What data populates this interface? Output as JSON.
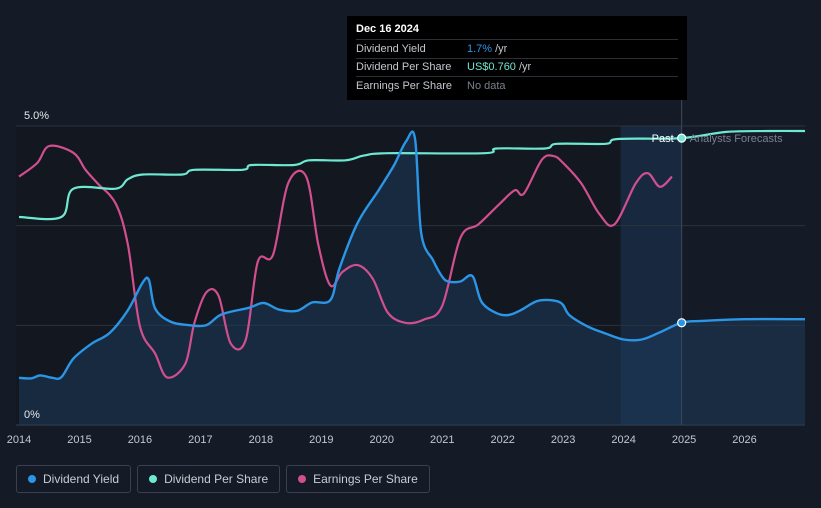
{
  "tooltip": {
    "date": "Dec 16 2024",
    "rows": [
      {
        "label": "Dividend Yield",
        "value": "1.7%",
        "unit": "/yr",
        "color": "#2b95e6"
      },
      {
        "label": "Dividend Per Share",
        "value": "US$0.760",
        "unit": "/yr",
        "color": "#6fe8d2"
      },
      {
        "label": "Earnings Per Share",
        "value": "No data",
        "unit": "",
        "color": "#7a808b"
      }
    ]
  },
  "legend": [
    {
      "label": "Dividend Yield",
      "color": "#2b95e6"
    },
    {
      "label": "Dividend Per Share",
      "color": "#6fe8d2"
    },
    {
      "label": "Earnings Per Share",
      "color": "#d14f8f"
    }
  ],
  "regions": {
    "past_label": "Past",
    "forecast_label": "Analysts Forecasts"
  },
  "chart_data": {
    "type": "line",
    "title": "",
    "xlabel": "",
    "ylabel": "",
    "x_ticks": [
      "2014",
      "2015",
      "2016",
      "2017",
      "2018",
      "2019",
      "2020",
      "2021",
      "2022",
      "2023",
      "2024",
      "2025",
      "2026"
    ],
    "xlim": [
      2013.95,
      2027.0
    ],
    "y_ticks": [
      "0%",
      "5.0%"
    ],
    "ylim": [
      0,
      5.0
    ],
    "grid": true,
    "legend_position": "bottom-left",
    "highlight_date": 2024.96,
    "series": [
      {
        "name": "Dividend Yield",
        "color": "#2b95e6",
        "unit": "%",
        "points": [
          [
            2014.0,
            0.79
          ],
          [
            2014.2,
            0.78
          ],
          [
            2014.35,
            0.83
          ],
          [
            2014.55,
            0.79
          ],
          [
            2014.7,
            0.8
          ],
          [
            2014.9,
            1.11
          ],
          [
            2015.2,
            1.36
          ],
          [
            2015.5,
            1.54
          ],
          [
            2015.8,
            1.92
          ],
          [
            2016.05,
            2.39
          ],
          [
            2016.15,
            2.42
          ],
          [
            2016.25,
            1.95
          ],
          [
            2016.5,
            1.73
          ],
          [
            2016.8,
            1.67
          ],
          [
            2017.1,
            1.67
          ],
          [
            2017.35,
            1.85
          ],
          [
            2017.8,
            1.96
          ],
          [
            2018.05,
            2.04
          ],
          [
            2018.3,
            1.93
          ],
          [
            2018.6,
            1.91
          ],
          [
            2018.85,
            2.05
          ],
          [
            2019.15,
            2.09
          ],
          [
            2019.3,
            2.62
          ],
          [
            2019.6,
            3.38
          ],
          [
            2019.95,
            3.93
          ],
          [
            2020.2,
            4.34
          ],
          [
            2020.4,
            4.74
          ],
          [
            2020.55,
            4.79
          ],
          [
            2020.65,
            3.22
          ],
          [
            2020.85,
            2.75
          ],
          [
            2021.0,
            2.48
          ],
          [
            2021.1,
            2.4
          ],
          [
            2021.3,
            2.4
          ],
          [
            2021.5,
            2.49
          ],
          [
            2021.65,
            2.06
          ],
          [
            2021.9,
            1.87
          ],
          [
            2022.1,
            1.84
          ],
          [
            2022.3,
            1.92
          ],
          [
            2022.6,
            2.08
          ],
          [
            2022.95,
            2.05
          ],
          [
            2023.1,
            1.84
          ],
          [
            2023.4,
            1.65
          ],
          [
            2023.7,
            1.53
          ],
          [
            2024.0,
            1.43
          ],
          [
            2024.3,
            1.43
          ],
          [
            2024.6,
            1.55
          ],
          [
            2024.96,
            1.71
          ],
          [
            2025.3,
            1.74
          ],
          [
            2026.0,
            1.77
          ],
          [
            2027.0,
            1.77
          ]
        ]
      },
      {
        "name": "Dividend Per Share",
        "color": "#6fe8d2",
        "unit": "US$",
        "points": [
          [
            2014.0,
            0.44
          ],
          [
            2014.7,
            0.44
          ],
          [
            2014.9,
            0.5
          ],
          [
            2015.6,
            0.5
          ],
          [
            2015.8,
            0.52
          ],
          [
            2016.05,
            0.53
          ],
          [
            2016.7,
            0.53
          ],
          [
            2016.9,
            0.54
          ],
          [
            2017.7,
            0.54
          ],
          [
            2017.85,
            0.55
          ],
          [
            2018.55,
            0.55
          ],
          [
            2018.8,
            0.56
          ],
          [
            2019.4,
            0.56
          ],
          [
            2019.7,
            0.57
          ],
          [
            2020.1,
            0.575
          ],
          [
            2021.7,
            0.575
          ],
          [
            2021.9,
            0.585
          ],
          [
            2022.7,
            0.585
          ],
          [
            2022.9,
            0.595
          ],
          [
            2023.7,
            0.595
          ],
          [
            2023.9,
            0.605
          ],
          [
            2024.96,
            0.607
          ],
          [
            2025.7,
            0.62
          ],
          [
            2026.4,
            0.622
          ],
          [
            2027.0,
            0.622
          ]
        ]
      },
      {
        "name": "Earnings Per Share",
        "color": "#d14f8f",
        "unit": "US$",
        "points": [
          [
            2014.0,
            0.73
          ],
          [
            2014.3,
            0.77
          ],
          [
            2014.5,
            0.82
          ],
          [
            2014.9,
            0.8
          ],
          [
            2015.1,
            0.75
          ],
          [
            2015.3,
            0.71
          ],
          [
            2015.6,
            0.65
          ],
          [
            2015.8,
            0.53
          ],
          [
            2016.0,
            0.29
          ],
          [
            2016.25,
            0.21
          ],
          [
            2016.45,
            0.14
          ],
          [
            2016.75,
            0.18
          ],
          [
            2016.9,
            0.3
          ],
          [
            2017.1,
            0.39
          ],
          [
            2017.3,
            0.38
          ],
          [
            2017.5,
            0.24
          ],
          [
            2017.75,
            0.25
          ],
          [
            2017.95,
            0.48
          ],
          [
            2018.2,
            0.5
          ],
          [
            2018.45,
            0.71
          ],
          [
            2018.75,
            0.73
          ],
          [
            2018.95,
            0.53
          ],
          [
            2019.15,
            0.41
          ],
          [
            2019.35,
            0.45
          ],
          [
            2019.6,
            0.47
          ],
          [
            2019.85,
            0.43
          ],
          [
            2020.1,
            0.33
          ],
          [
            2020.4,
            0.3
          ],
          [
            2020.7,
            0.31
          ],
          [
            2021.0,
            0.35
          ],
          [
            2021.3,
            0.55
          ],
          [
            2021.6,
            0.59
          ],
          [
            2021.95,
            0.65
          ],
          [
            2022.2,
            0.69
          ],
          [
            2022.35,
            0.68
          ],
          [
            2022.65,
            0.78
          ],
          [
            2022.85,
            0.79
          ],
          [
            2023.0,
            0.77
          ],
          [
            2023.3,
            0.71
          ],
          [
            2023.6,
            0.62
          ],
          [
            2023.85,
            0.59
          ],
          [
            2024.2,
            0.71
          ],
          [
            2024.4,
            0.74
          ],
          [
            2024.6,
            0.7
          ],
          [
            2024.8,
            0.73
          ]
        ]
      }
    ]
  }
}
